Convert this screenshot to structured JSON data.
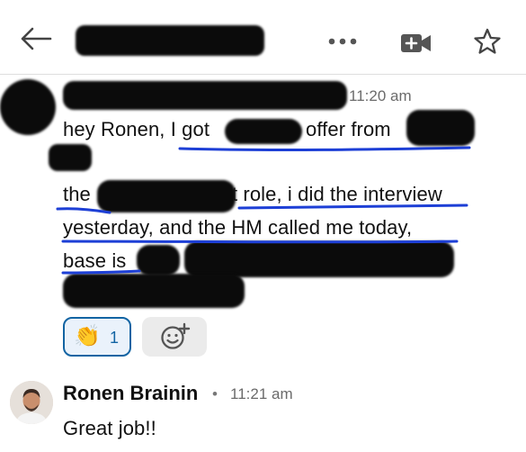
{
  "colors": {
    "accent": "#1264a3",
    "pen": "#1d3fd6",
    "text": "#111111",
    "muted": "#6b6b6b"
  },
  "header": {
    "back_icon": "arrow-left-icon",
    "more_icon": "ellipsis-icon",
    "video_icon": "video-plus-icon",
    "star_icon": "star-icon"
  },
  "message1": {
    "time": "11:20 am",
    "line1": {
      "a": "hey Ronen, I got",
      "b": "offer from"
    },
    "line2": {
      "a": "the",
      "b": "t role, i did the interview"
    },
    "line3": "yesterday, and the HM called me today,",
    "line4": "base is",
    "reaction": {
      "emoji": "👏",
      "count": "1"
    },
    "add_reaction_icon": "add-reaction-icon"
  },
  "message2": {
    "author": "Ronen Brainin",
    "separator": "•",
    "time": "11:21 am",
    "text": "Great job!!"
  }
}
